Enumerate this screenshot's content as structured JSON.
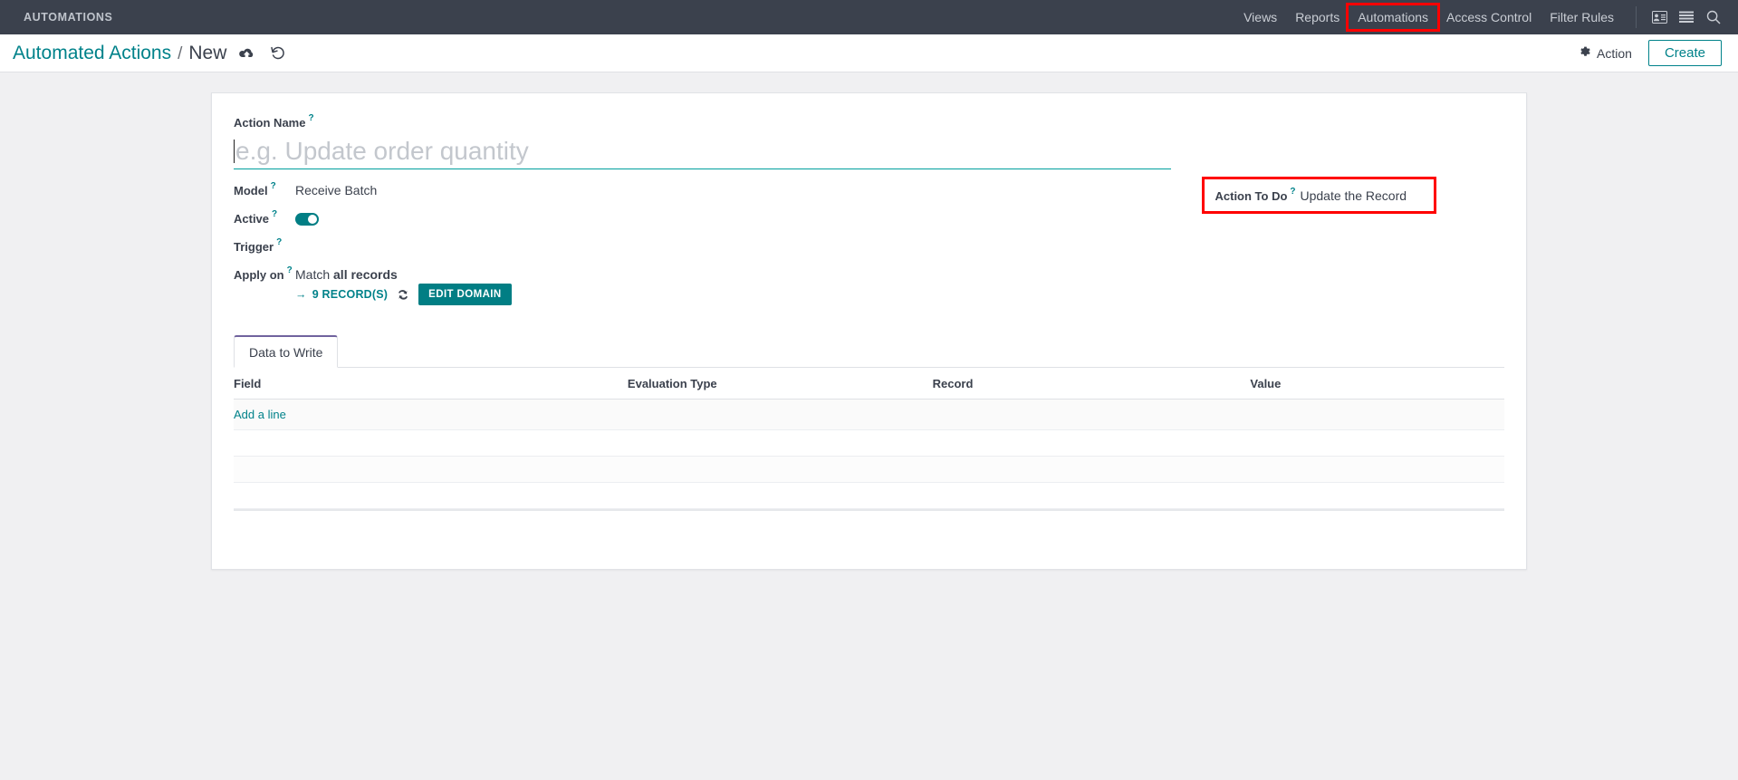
{
  "navbar": {
    "brand": "AUTOMATIONS",
    "menu": [
      {
        "label": "Views",
        "highlighted": false
      },
      {
        "label": "Reports",
        "highlighted": false
      },
      {
        "label": "Automations",
        "highlighted": true
      },
      {
        "label": "Access Control",
        "highlighted": false
      },
      {
        "label": "Filter Rules",
        "highlighted": false
      }
    ],
    "icons": [
      {
        "name": "contacts-icon"
      },
      {
        "name": "activities-list-icon"
      },
      {
        "name": "search-icon"
      }
    ]
  },
  "control_panel": {
    "breadcrumb_parent": "Automated Actions",
    "breadcrumb_separator": "/",
    "breadcrumb_current": "New",
    "save_icon_name": "cloud-upload-icon",
    "discard_icon_name": "undo-icon",
    "action_label": "Action",
    "create_label": "Create"
  },
  "form": {
    "action_name": {
      "label": "Action Name",
      "help": "?",
      "value": "",
      "placeholder": "e.g. Update order quantity"
    },
    "model": {
      "label": "Model",
      "help": "?",
      "value": "Receive Batch"
    },
    "active": {
      "label": "Active",
      "help": "?",
      "value": "on"
    },
    "trigger": {
      "label": "Trigger",
      "help": "?",
      "value": ""
    },
    "apply_on": {
      "label": "Apply on",
      "help": "?",
      "value_prefix": "Match ",
      "value_strong": "all records",
      "records_label": "9 RECORD(S)",
      "arrow_glyph": "→",
      "refresh_icon_name": "refresh-icon",
      "edit_domain_label": "EDIT DOMAIN"
    },
    "action_to_do": {
      "label": "Action To Do",
      "help": "?",
      "value": "Update the Record",
      "highlighted": true
    }
  },
  "notebook": {
    "tabs": [
      {
        "label": "Data to Write",
        "active": true
      }
    ],
    "columns": [
      "Field",
      "Evaluation Type",
      "Record",
      "Value"
    ],
    "rows": [],
    "add_line_label": "Add a line"
  },
  "colors": {
    "navbar_bg": "#3b414d",
    "accent_teal": "#00a09d",
    "link_teal": "#00828a",
    "button_teal": "#017e84",
    "highlight_red": "#ff0000",
    "tab_active_border": "#71639e",
    "page_bg": "#f0f0f2"
  }
}
